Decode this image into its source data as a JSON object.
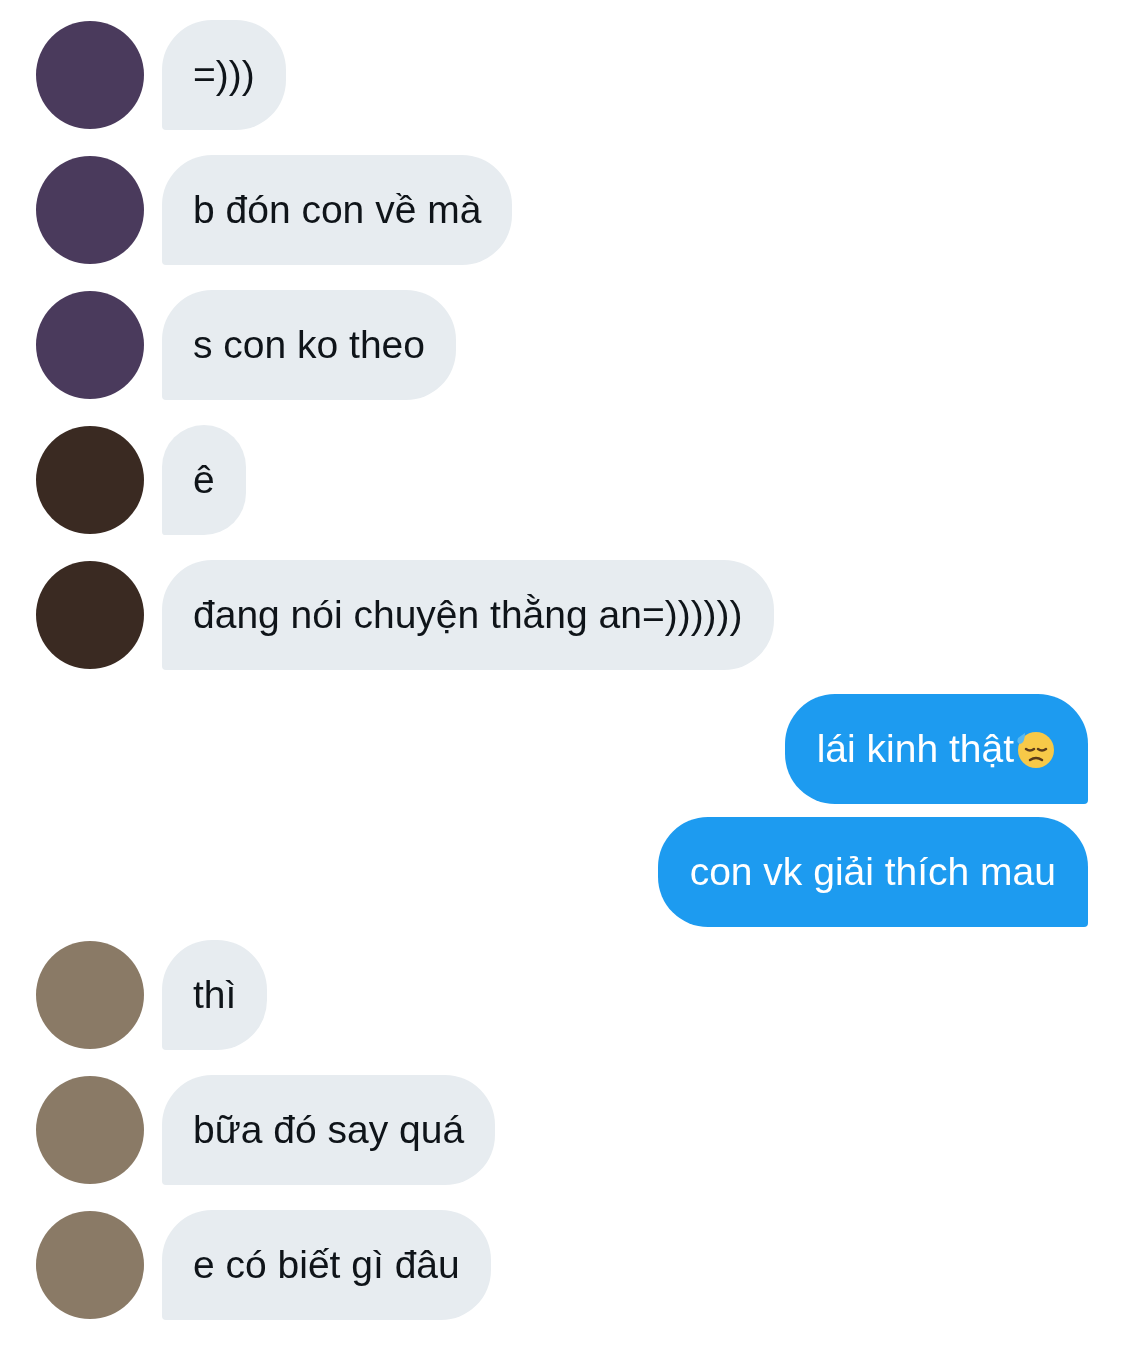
{
  "messages": [
    {
      "kind": "incoming",
      "text": "=)))",
      "color": "#4a3a5c"
    },
    {
      "kind": "incoming",
      "text": "b đón con về mà",
      "color": "#4a3a5c"
    },
    {
      "kind": "incoming",
      "text": "s con ko theo",
      "color": "#4a3a5c"
    },
    {
      "kind": "incoming",
      "text": "ê",
      "color": "#3a2a22"
    },
    {
      "kind": "incoming",
      "text": "đang nói chuyện thằng an=))))))",
      "color": "#3a2a22"
    },
    {
      "kind": "outgoing",
      "text": "lái kinh thật",
      "emoji": true
    },
    {
      "kind": "outgoing",
      "text": "con vk giải thích mau",
      "emoji": false
    },
    {
      "kind": "incoming",
      "text": "thì",
      "color": "#8a7a66"
    },
    {
      "kind": "incoming",
      "text": "bữa đó say quá",
      "color": "#8a7a66"
    },
    {
      "kind": "incoming",
      "text": "e có biết gì đâu",
      "color": "#8a7a66"
    }
  ]
}
